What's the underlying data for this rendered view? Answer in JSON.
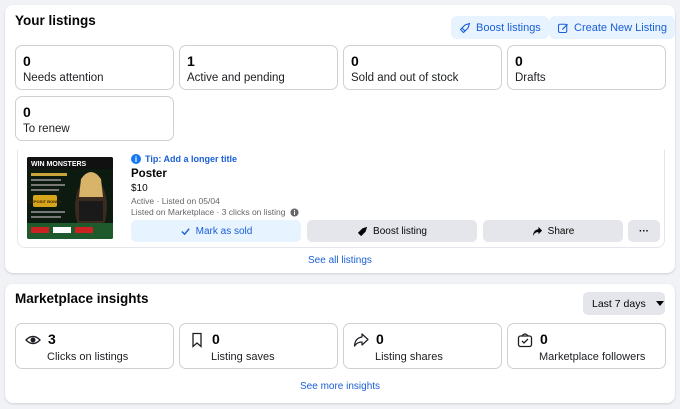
{
  "listings_section": {
    "title": "Your listings",
    "boost_button": "Boost listings",
    "create_button": "Create New Listing",
    "stats": [
      {
        "value": "0",
        "label": "Needs attention"
      },
      {
        "value": "1",
        "label": "Active and pending"
      },
      {
        "value": "0",
        "label": "Sold and out of stock"
      },
      {
        "value": "0",
        "label": "Drafts"
      },
      {
        "value": "0",
        "label": "To renew"
      }
    ],
    "listing": {
      "tip": "Tip: Add a longer title",
      "title": "Poster",
      "price": "$10",
      "status": "Active · Listed on 05/04",
      "marketplace_info": "Listed on Marketplace · 3 clicks on listing",
      "image_text_top": "WIN MONSTERS",
      "image_text_badge": "DEPOSIT BONUS",
      "actions": {
        "mark_sold": "Mark as sold",
        "boost": "Boost listing",
        "share": "Share",
        "more": "···"
      }
    },
    "see_all": "See all listings"
  },
  "insights_section": {
    "title": "Marketplace insights",
    "range": "Last 7 days",
    "stats": [
      {
        "value": "3",
        "label": "Clicks on listings",
        "icon": "eye-icon"
      },
      {
        "value": "0",
        "label": "Listing saves",
        "icon": "bookmark-icon"
      },
      {
        "value": "0",
        "label": "Listing shares",
        "icon": "share-icon"
      },
      {
        "value": "0",
        "label": "Marketplace followers",
        "icon": "followers-icon"
      }
    ],
    "see_more": "See more insights"
  },
  "colors": {
    "accent": "#1877f2",
    "link": "#1a5fd6",
    "pill_bg": "#e7f3ff",
    "page_bg": "#f0f2f5"
  }
}
